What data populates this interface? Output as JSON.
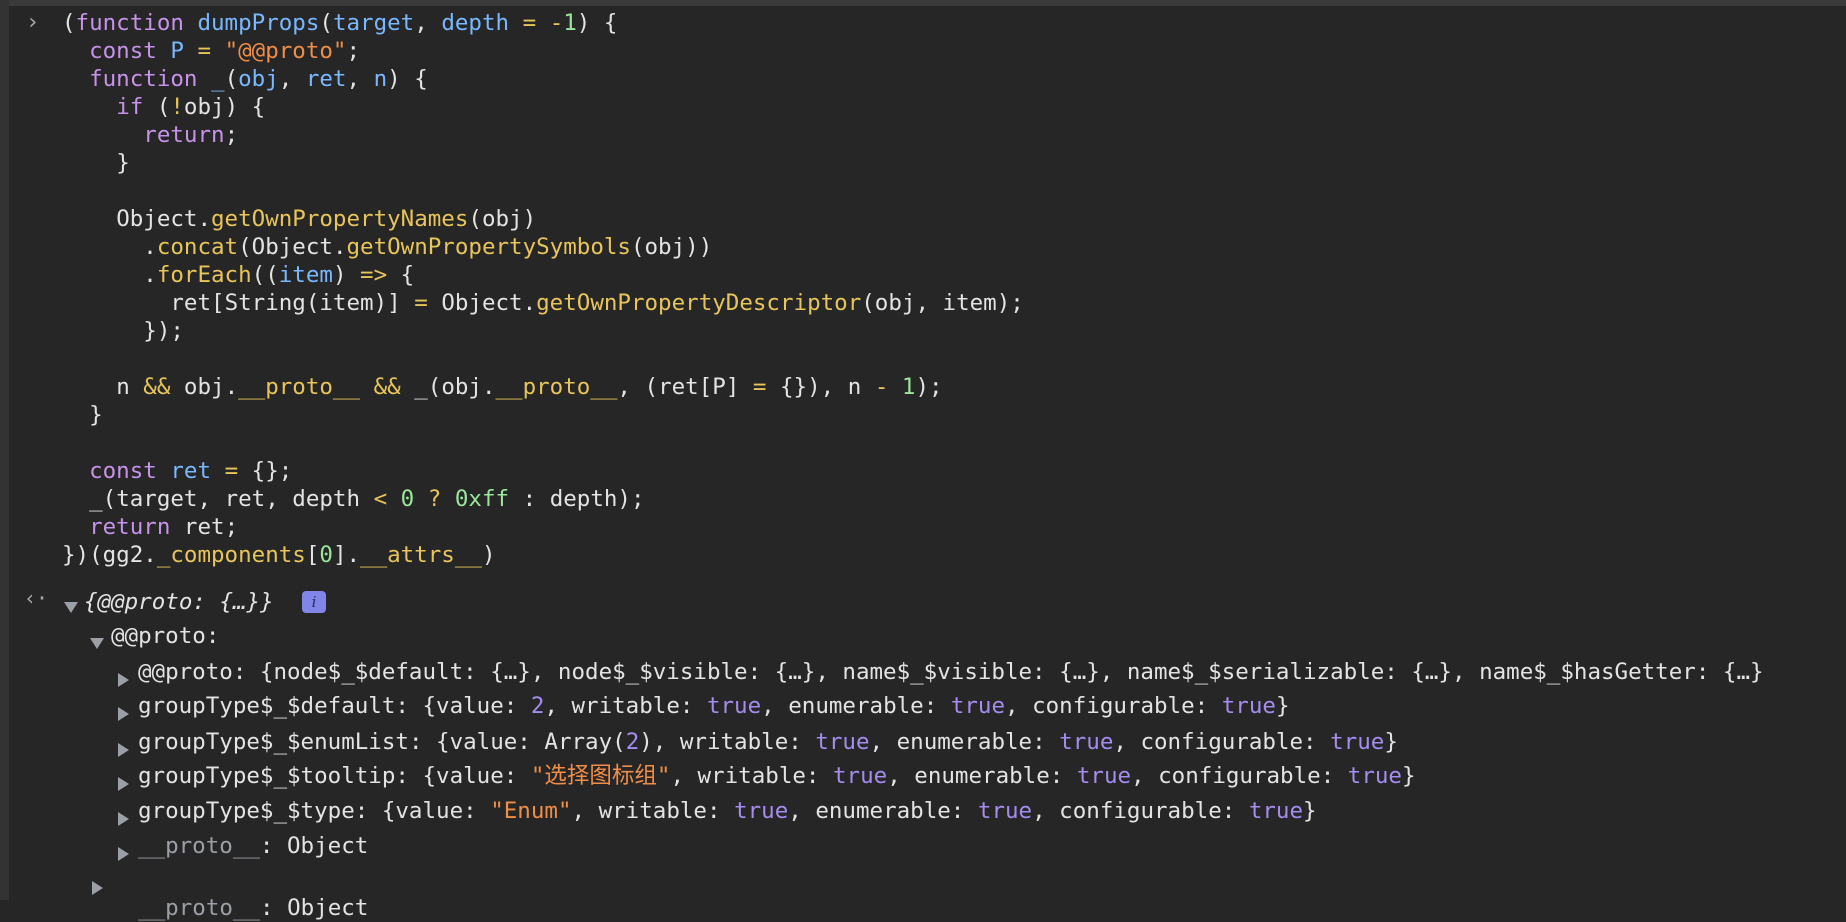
{
  "console": {
    "input_lines": [
      "(function dumpProps(target, depth = -1) {",
      "  const P = \"@@proto\";",
      "  function _(obj, ret, n) {",
      "    if (!obj) {",
      "      return;",
      "    }",
      "",
      "    Object.getOwnPropertyNames(obj)",
      "      .concat(Object.getOwnPropertySymbols(obj))",
      "      .forEach((item) => {",
      "        ret[String(item)] = Object.getOwnPropertyDescriptor(obj, item);",
      "      });",
      "",
      "    n && obj.__proto__ && _(obj.__proto__, (ret[P] = {}), n - 1);",
      "  }",
      "",
      "  const ret = {};",
      "  _(target, ret, depth < 0 ? 0xff : depth);",
      "  return ret;",
      "})(gg2._components[0].__attrs__)"
    ],
    "result": {
      "summary": "{@@proto: {…}}",
      "info_badge": "i",
      "proto_label": "@@proto:",
      "entries": [
        {
          "key": "@@proto",
          "value": "{node$_$default: {…}, node$_$visible: {…}, name$_$visible: {…}, name$_$serializable: {…}, name$_$hasGetter: {…}"
        },
        {
          "key": "groupType$_$default",
          "value": "{value: 2, writable: true, enumerable: true, configurable: true}"
        },
        {
          "key": "groupType$_$enumList",
          "value": "{value: Array(2), writable: true, enumerable: true, configurable: true}"
        },
        {
          "key": "groupType$_$tooltip",
          "value": "{value: \"选择图标组\", writable: true, enumerable: true, configurable: true}"
        },
        {
          "key": "groupType$_$type",
          "value": "{value: \"Enum\", writable: true, enumerable: true, configurable: true}"
        },
        {
          "key": "__proto__",
          "value": "Object"
        }
      ],
      "outer_proto": {
        "key": "__proto__",
        "value": "Object"
      }
    }
  },
  "icons": {
    "prompt": "chevron-right-icon",
    "return": "return-arrow-icon"
  }
}
